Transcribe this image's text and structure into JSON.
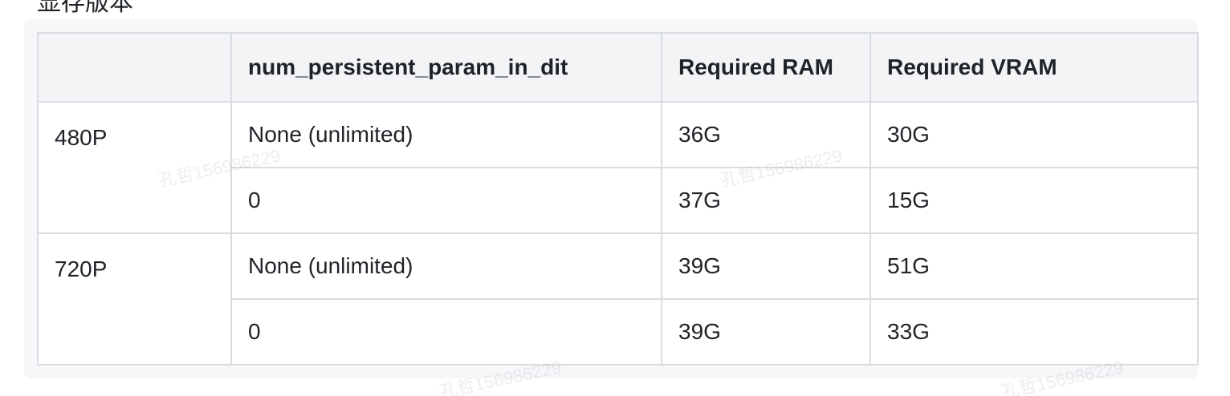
{
  "clipped_heading": "显存版本",
  "table": {
    "headers": [
      "",
      "num_persistent_param_in_dit",
      "Required RAM",
      "Required VRAM"
    ],
    "rows": [
      {
        "resolution": "480P",
        "param": "None (unlimited)",
        "ram": "36G",
        "vram": "30G"
      },
      {
        "resolution": "",
        "param": "0",
        "ram": "37G",
        "vram": "15G"
      },
      {
        "resolution": "720P",
        "param": "None (unlimited)",
        "ram": "39G",
        "vram": "51G"
      },
      {
        "resolution": "",
        "param": "0",
        "ram": "39G",
        "vram": "33G"
      }
    ]
  },
  "watermark_text": "孔哲156986229"
}
